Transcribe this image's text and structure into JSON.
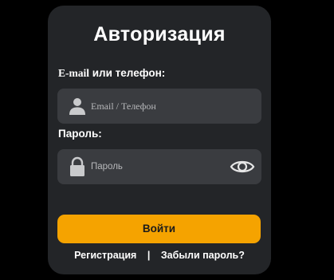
{
  "form": {
    "title": "Авторизация",
    "email_label_prefix": "E-mail",
    "email_label_rest": " или телефон:",
    "email_placeholder": "Email / Телефон",
    "password_label": "Пароль:",
    "password_placeholder": "Пароль",
    "submit_label": "Войти",
    "register_link": "Регистрация",
    "separator": "|",
    "forgot_link": "Забыли пароль?"
  },
  "colors": {
    "background": "#000000",
    "card": "#232528",
    "input": "#3a3c40",
    "accent": "#f5a300",
    "icon": "#c9cacc"
  },
  "icons": {
    "email_field": "user-icon",
    "password_field": "lock-icon",
    "toggle_visibility": "eye-icon"
  }
}
